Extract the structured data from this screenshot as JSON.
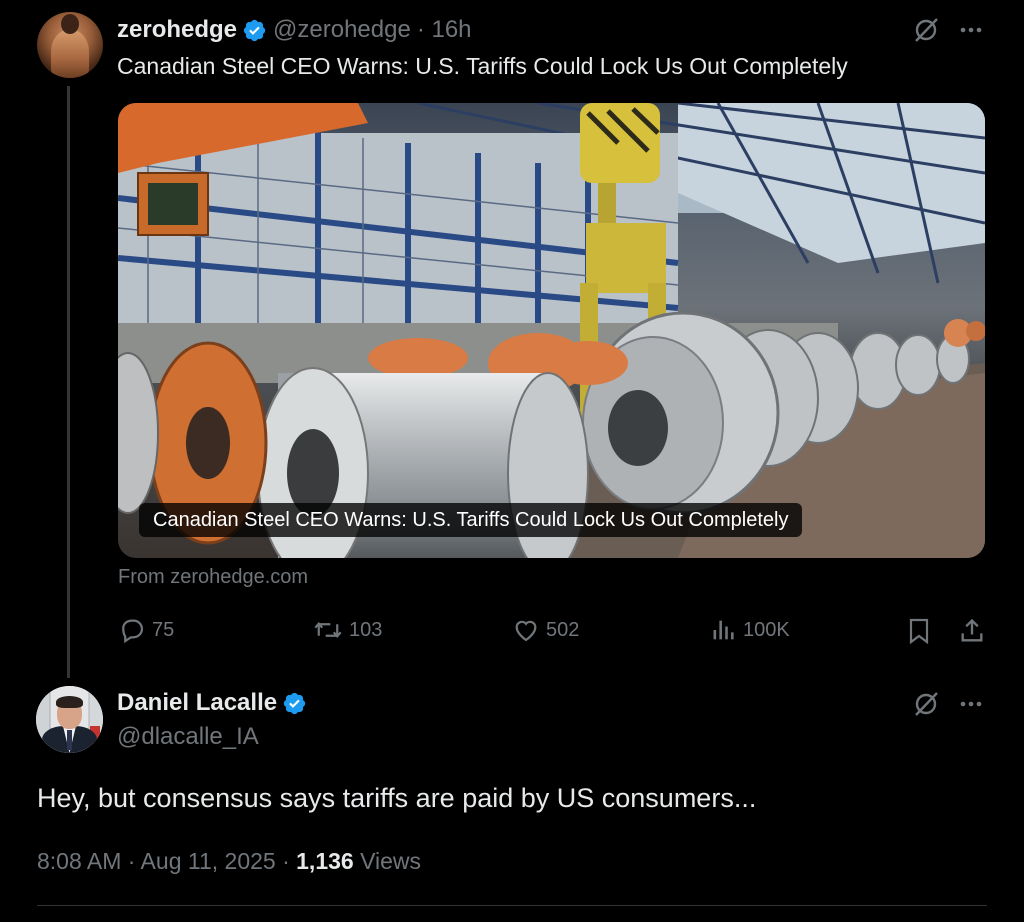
{
  "quoted_tweet": {
    "author_name": "zerohedge",
    "author_handle": "@zerohedge",
    "time_ago": "· 16h",
    "text": "Canadian Steel CEO Warns: U.S. Tariffs Could Lock Us Out Completely",
    "card": {
      "caption": "Canadian Steel CEO Warns: U.S. Tariffs Could Lock Us Out Completely",
      "source": "From zerohedge.com"
    },
    "actions": {
      "replies": "75",
      "reposts": "103",
      "likes": "502",
      "views": "100K"
    },
    "icons": [
      "grok-icon",
      "more-icon",
      "reply-icon",
      "repost-icon",
      "like-icon",
      "views-icon",
      "bookmark-icon",
      "share-icon"
    ]
  },
  "main_tweet": {
    "author_name": "Daniel Lacalle",
    "author_handle": "@dlacalle_IA",
    "text": "Hey, but consensus says tariffs are paid by US consumers...",
    "time": "8:08 AM",
    "date": "· Aug 11, 2025 ·",
    "views_count": "1,136",
    "views_label": "Views"
  },
  "colors": {
    "background": "#000000",
    "text": "#e7e9ea",
    "muted": "#71767b",
    "verified": "#1d9bf0"
  }
}
